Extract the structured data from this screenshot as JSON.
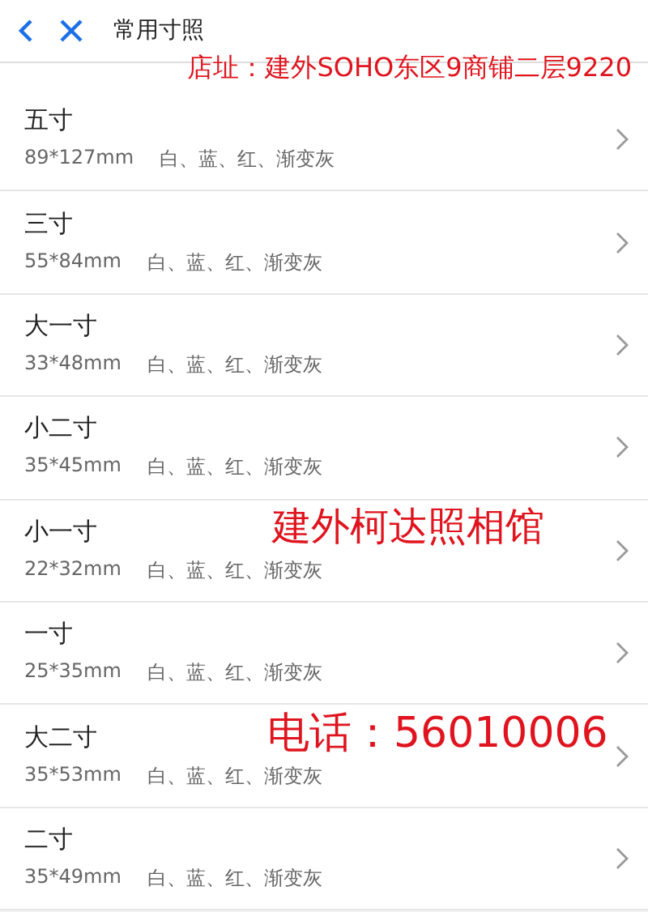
{
  "header": {
    "title": "常用寸照"
  },
  "overlays": [
    {
      "kind": "address",
      "text": "店址：建外SOHO东区9商铺二层9220"
    },
    {
      "kind": "shop",
      "text": "建外柯达照相馆"
    },
    {
      "kind": "phone",
      "text": "电话：56010006"
    }
  ],
  "items": [
    {
      "name": "五寸",
      "size": "89*127mm",
      "colors": "白、蓝、红、渐变灰"
    },
    {
      "name": "三寸",
      "size": "55*84mm",
      "colors": "白、蓝、红、渐变灰"
    },
    {
      "name": "大一寸",
      "size": "33*48mm",
      "colors": "白、蓝、红、渐变灰"
    },
    {
      "name": "小二寸",
      "size": "35*45mm",
      "colors": "白、蓝、红、渐变灰"
    },
    {
      "name": "小一寸",
      "size": "22*32mm",
      "colors": "白、蓝、红、渐变灰"
    },
    {
      "name": "一寸",
      "size": "25*35mm",
      "colors": "白、蓝、红、渐变灰"
    },
    {
      "name": "大二寸",
      "size": "35*53mm",
      "colors": "白、蓝、红、渐变灰"
    },
    {
      "name": "二寸",
      "size": "35*49mm",
      "colors": "白、蓝、红、渐变灰"
    }
  ]
}
